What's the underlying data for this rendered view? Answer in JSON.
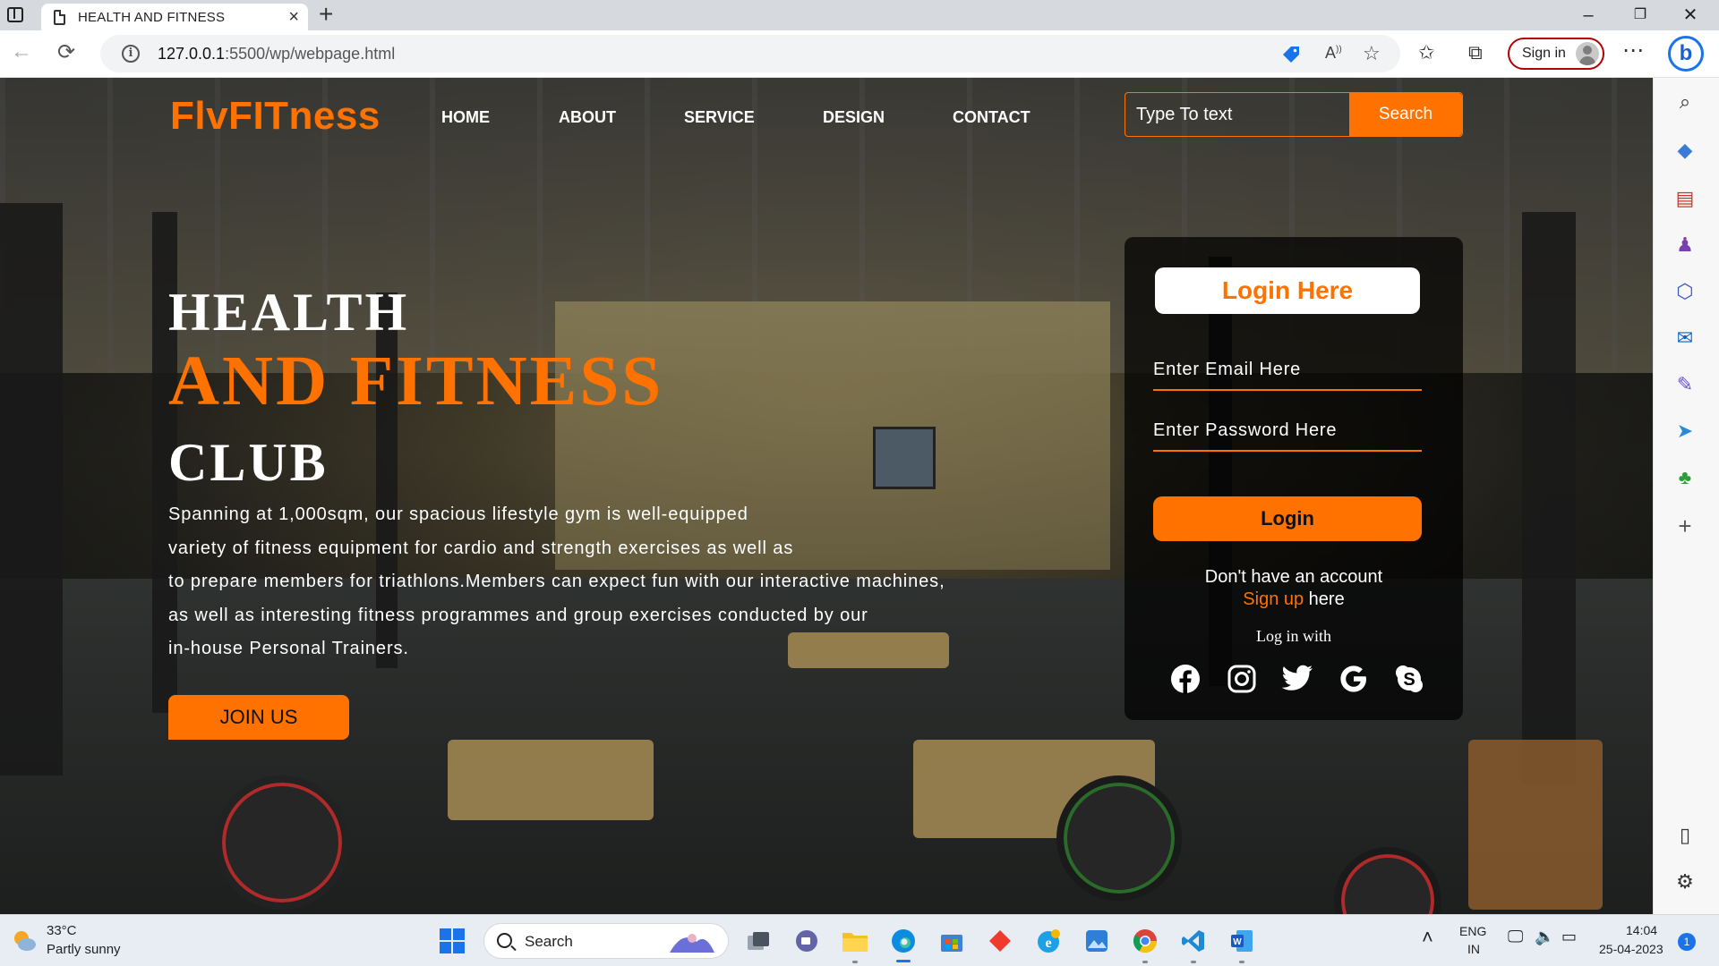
{
  "browser": {
    "tab_title": "HEALTH AND FITNESS",
    "new_tab": "+",
    "url_host": "127.0.0.1",
    "url_path": ":5500/wp/webpage.html",
    "sign_in": "Sign in"
  },
  "site": {
    "logo": "FlvFITness",
    "nav": [
      "HOME",
      "ABOUT",
      "SERVICE",
      "DESIGN",
      "CONTACT"
    ],
    "search_placeholder": "Type To text",
    "search_button": "Search"
  },
  "hero": {
    "line1": "HEALTH",
    "line2": "AND FITNESS",
    "line3": "CLUB",
    "description": [
      "Spanning at 1,000sqm, our spacious lifestyle gym is well-equipped",
      "variety of fitness equipment for cardio and strength exercises as well as",
      "to prepare members for triathlons.Members can expect fun with our interactive machines,",
      "as well as interesting fitness programmes and group exercises conducted by our",
      "in-house Personal Trainers."
    ],
    "cta": "JOIN US"
  },
  "login": {
    "title": "Login Here",
    "email_placeholder": "Enter Email Here",
    "password_placeholder": "Enter Password Here",
    "button": "Login",
    "no_account": "Don't have an account",
    "signup_link": "Sign up",
    "signup_suffix": " here",
    "login_with": "Log in with",
    "social": [
      "facebook-icon",
      "instagram-icon",
      "twitter-icon",
      "google-icon",
      "skype-icon"
    ]
  },
  "taskbar": {
    "weather_temp": "33°C",
    "weather_desc": "Partly sunny",
    "search": "Search",
    "lang_top": "ENG",
    "lang_bottom": "IN",
    "time": "14:04",
    "date": "25-04-2023",
    "notifications": "1"
  },
  "colors": {
    "accent": "#ff7200",
    "edge_blue": "#1a73e8",
    "signin_border": "#b30000"
  }
}
